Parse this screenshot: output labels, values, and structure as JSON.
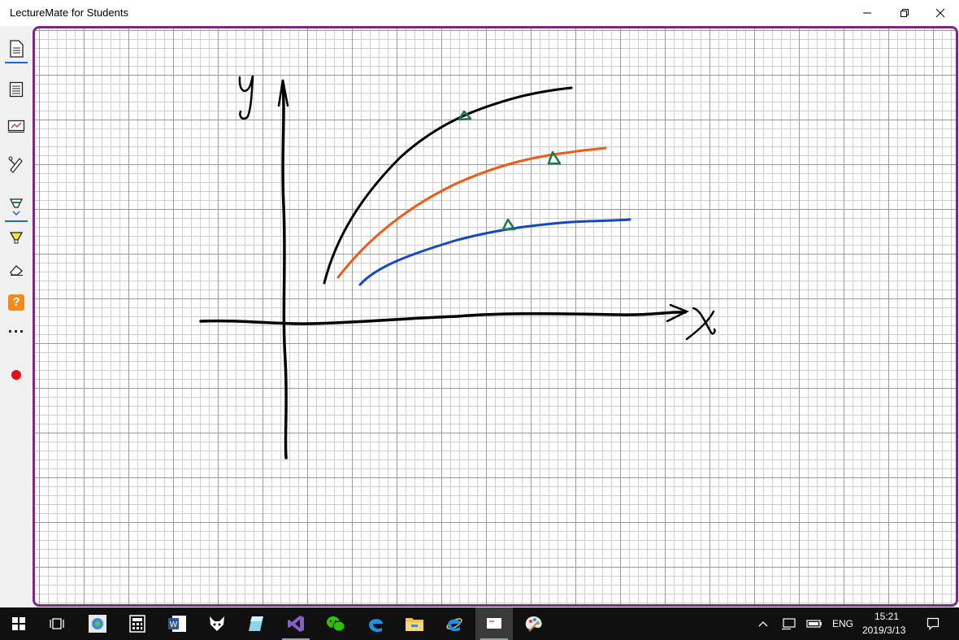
{
  "window": {
    "title": "LectureMate for Students",
    "minimize_label": "–"
  },
  "toolbar": {
    "items": [
      {
        "name": "document",
        "icon": "document-icon"
      },
      {
        "name": "notebook",
        "icon": "notebook-icon"
      },
      {
        "name": "slide-board",
        "icon": "slide-board-icon"
      },
      {
        "name": "pen-settings",
        "icon": "pen-settings-icon"
      },
      {
        "name": "pen",
        "icon": "pen-icon"
      },
      {
        "name": "highlighter",
        "icon": "highlighter-icon"
      },
      {
        "name": "eraser",
        "icon": "eraser-icon"
      },
      {
        "name": "help",
        "icon": "question-icon",
        "label": "?"
      },
      {
        "name": "more",
        "icon": "ellipsis-icon",
        "label": "···"
      },
      {
        "name": "record",
        "icon": "record-dot-icon"
      }
    ]
  },
  "canvas": {
    "y_label": "y",
    "x_label": "x",
    "ink_colors": {
      "black": "#000000",
      "orange": "#f05a14",
      "blue": "#1446c8",
      "green": "#1a7a4a"
    }
  },
  "taskbar": {
    "apps": [
      "start-icon",
      "task-view-icon",
      "photos-icon",
      "calculator-icon",
      "word-icon",
      "fox-app-icon",
      "notes-app-icon",
      "visual-studio-icon",
      "wechat-icon",
      "edge-icon",
      "file-explorer-icon",
      "internet-explorer-icon",
      "lecturemate-icon",
      "paint-icon"
    ],
    "language": "ENG",
    "time": "15:21",
    "date": "2019/3/13"
  }
}
